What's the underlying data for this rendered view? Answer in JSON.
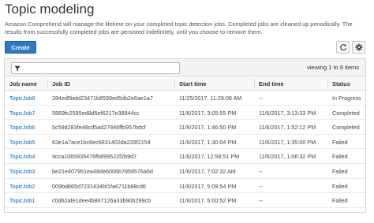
{
  "header": {
    "title": "Topic modeling",
    "description": "Amazon Comprehend will manage the lifetime on your completed topic detection jobs. Completed jobs are cleaned up periodically. The results from successfully completed jobs are persisted indefinitely, until you choose to remove them."
  },
  "toolbar": {
    "create_label": "Create",
    "refresh_icon": "refresh-icon",
    "settings_icon": "gear-icon"
  },
  "filter": {
    "placeholder": "",
    "value": "",
    "icon": "filter-icon"
  },
  "pagination": {
    "viewing_text": "viewing 1 to 8 items"
  },
  "table": {
    "columns": [
      "Job name",
      "Job ID",
      "Start time",
      "End time",
      "Status"
    ],
    "rows": [
      {
        "name": "TopicJob8",
        "id": "284ed5bdd23471b8539ed5db2e6ae1a7",
        "start": "11/25/2017, 11:29:08 AM",
        "end": "--",
        "status": "In Progress"
      },
      {
        "name": "TopicJob7",
        "id": "5869fc2595ed8d5ef6217e38944cc",
        "start": "11/6/2017, 3:05:55 PM",
        "end": "11/6/2017, 3:13:33 PM",
        "status": "Completed"
      },
      {
        "name": "TopicJob6",
        "id": "5c59d283fe48cd5ad27848ffb957bdcf",
        "start": "11/6/2017, 1:46:50 PM",
        "end": "11/6/2017, 1:52:12 PM",
        "status": "Completed"
      },
      {
        "name": "TopicJob5",
        "id": "63e1a7ace1bc6ec6831402da228f2154",
        "start": "11/6/2017, 1:30:04 PM",
        "end": "11/6/2017, 1:35:00 PM",
        "status": "Failed"
      },
      {
        "name": "TopicJob4",
        "id": "9cca1065935476fb899522f2b9d7",
        "start": "11/6/2017, 12:58:51 PM",
        "end": "11/6/2017, 1:06:32 PM",
        "status": "Failed"
      },
      {
        "name": "TopicJob3",
        "id": "be21e407951ea48de6006b7859576a5d",
        "start": "11/6/2017, 7:02:32 AM",
        "end": "--",
        "status": "Failed"
      },
      {
        "name": "TopicJob2",
        "id": "009bd865d7231434bf1fa6711b88cd6",
        "start": "11/6/2017, 5:09:54 PM",
        "end": "--",
        "status": "Failed"
      },
      {
        "name": "TopicJob1",
        "id": "c0d62afe1dee4b867126a33b90b299cb",
        "start": "11/6/2017, 5:00:52 PM",
        "end": "--",
        "status": "Failed"
      }
    ]
  }
}
